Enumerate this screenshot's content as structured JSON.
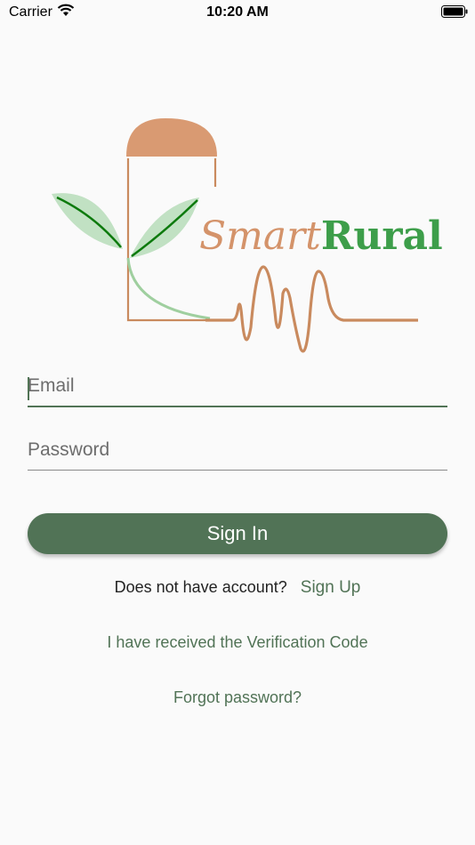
{
  "status_bar": {
    "carrier": "Carrier",
    "time": "10:20 AM"
  },
  "logo": {
    "word_smart": "Smart",
    "word_rural": "Rural",
    "colors": {
      "brown": "#d4936a",
      "green": "#3d9e4a",
      "leaf": "#0d7a0d"
    }
  },
  "form": {
    "email_placeholder": "Email",
    "password_placeholder": "Password",
    "sign_in_label": "Sign In",
    "no_account_prompt": "Does not have account?",
    "sign_up_label": "Sign Up",
    "verification_label": "I have received the Verification Code",
    "forgot_label": "Forgot password?"
  },
  "colors": {
    "primary": "#517356",
    "background": "#fafafa"
  }
}
